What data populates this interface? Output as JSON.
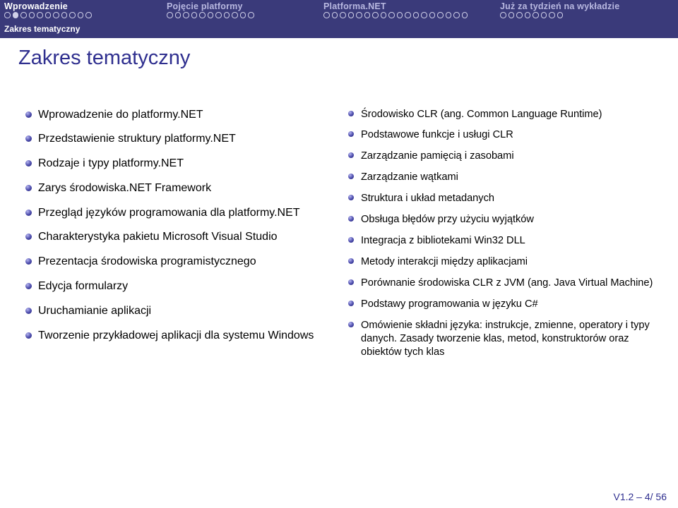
{
  "nav": {
    "sections": [
      {
        "label": "Wprowadzenie",
        "active": true,
        "dots_total": 11,
        "dots_filled_index": 1
      },
      {
        "label": "Pojęcie platformy",
        "active": false,
        "dots_total": 11,
        "dots_filled_index": -1
      },
      {
        "label": "Platforma.NET",
        "active": false,
        "dots_total": 18,
        "dots_filled_index": -1
      },
      {
        "label": "Już za tydzień na wykładzie",
        "active": false,
        "dots_total": 8,
        "dots_filled_index": -1
      }
    ],
    "subsection": "Zakres tematyczny"
  },
  "title": "Zakres tematyczny",
  "left_items": [
    "Wprowadzenie do platformy.NET",
    "Przedstawienie struktury platformy.NET",
    "Rodzaje i typy platformy.NET",
    "Zarys środowiska.NET Framework",
    "Przegląd języków programowania dla platformy.NET",
    "Charakterystyka pakietu Microsoft Visual Studio",
    "Prezentacja środowiska programistycznego",
    "Edycja formularzy",
    "Uruchamianie aplikacji",
    "Tworzenie przykładowej aplikacji dla systemu Windows"
  ],
  "right_items": [
    "Środowisko CLR (ang. Common Language Runtime)",
    "Podstawowe funkcje i usługi CLR",
    "Zarządzanie pamięcią i zasobami",
    "Zarządzanie wątkami",
    "Struktura i układ metadanych",
    "Obsługa błędów przy użyciu wyjątków",
    "Integracja z bibliotekami Win32 DLL",
    "Metody interakcji między aplikacjami",
    "Porównanie środowiska CLR z JVM (ang. Java Virtual Machine)",
    "Podstawy programowania w języku C#",
    "Omówienie składni języka: instrukcje, zmienne, operatory i typy danych. Zasady tworzenie klas, metod, konstruktorów oraz obiektów tych klas"
  ],
  "footer": "V1.2 – 4/ 56"
}
